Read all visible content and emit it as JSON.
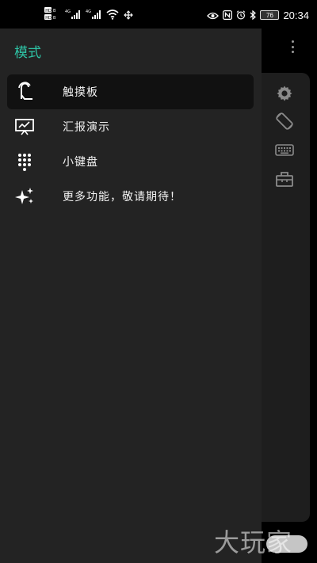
{
  "status_bar": {
    "time": "20:34",
    "battery": "76",
    "left_icons": [
      "hd-dual-icon",
      "signal-4g-icon",
      "signal-4g-icon",
      "wifi-icon",
      "data-sync-icon"
    ],
    "right_icons": [
      "eye-icon",
      "nfc-icon",
      "alarm-icon",
      "bluetooth-icon",
      "battery-icon"
    ]
  },
  "drawer": {
    "title": "模式",
    "items": [
      {
        "label": "触摸板",
        "icon": "touch-gesture-icon",
        "active": true
      },
      {
        "label": "汇报演示",
        "icon": "presentation-icon",
        "active": false
      },
      {
        "label": "小键盘",
        "icon": "dialpad-icon",
        "active": false
      },
      {
        "label": "更多功能，敬请期待！",
        "icon": "sparkle-icon",
        "active": false
      }
    ]
  },
  "toolbar": {
    "icons": [
      "settings-gear-icon",
      "screen-rotate-icon",
      "keyboard-icon",
      "toolbox-icon"
    ],
    "overflow_icon": "more-vertical-icon"
  },
  "watermark": "大玩家",
  "colors": {
    "accent": "#2ec4a6",
    "drawer_bg": "#232323",
    "active_item_bg": "#111111",
    "rail_bg": "#1e1e1e",
    "icon_gray": "#8a8a8a"
  }
}
